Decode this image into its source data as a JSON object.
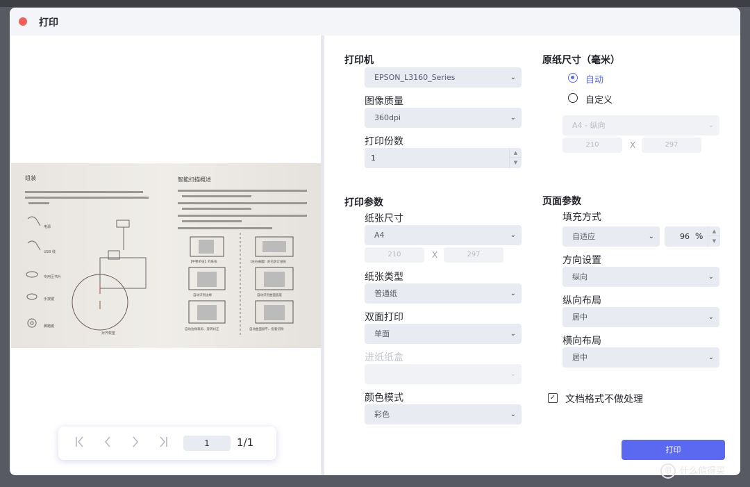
{
  "window": {
    "title": "打印"
  },
  "pager": {
    "page_value": "1",
    "total": "1/1"
  },
  "printer": {
    "section": "打印机",
    "printer_value": "EPSON_L3160_Series",
    "quality_label": "图像质量",
    "quality_value": "360dpi",
    "copies_label": "打印份数",
    "copies_value": "1"
  },
  "original": {
    "section": "原纸尺寸（毫米）",
    "auto_label": "自动",
    "custom_label": "自定义",
    "size_value": "A4 - 纵向",
    "width": "210",
    "height": "297",
    "x": "X"
  },
  "params": {
    "section": "打印参数",
    "paper_size_label": "纸张尺寸",
    "paper_size_value": "A4",
    "width": "210",
    "height": "297",
    "x": "X",
    "paper_type_label": "纸张类型",
    "paper_type_value": "普通纸",
    "duplex_label": "双面打印",
    "duplex_value": "单面",
    "tray_label": "进纸纸盒",
    "tray_value": "",
    "color_label": "颜色模式",
    "color_value": "彩色"
  },
  "page": {
    "section": "页面参数",
    "fill_label": "填充方式",
    "fill_value": "自适应",
    "scale_value": "96",
    "scale_unit": "%",
    "orient_label": "方向设置",
    "orient_value": "纵向",
    "vlayout_label": "纵向布局",
    "vlayout_value": "居中",
    "hlayout_label": "横向布局",
    "hlayout_value": "居中",
    "keep_format_label": "文档格式不做处理"
  },
  "actions": {
    "print_label": "打印"
  },
  "watermark": {
    "icon": "值",
    "text": "什么值得买"
  },
  "preview_doc": {
    "left_heading": "组装",
    "right_heading": "智能扫描概述",
    "items": [
      "电源",
      "USB 线",
      "专用压书片",
      "手按键",
      "脚踏键"
    ],
    "left_caption": "对齐软垫",
    "thumb_captions": [
      "【平整单张】的纸张",
      "【左右曲面】的已装订纸张",
      "自动识别边缘",
      "自动识别曲面弧度",
      "自动边缘裁剪、旋转纠正",
      "自动曲面展平、指套切除"
    ]
  },
  "colors": {
    "accent": "#5b68f0",
    "close_dot": "#f35f56"
  }
}
